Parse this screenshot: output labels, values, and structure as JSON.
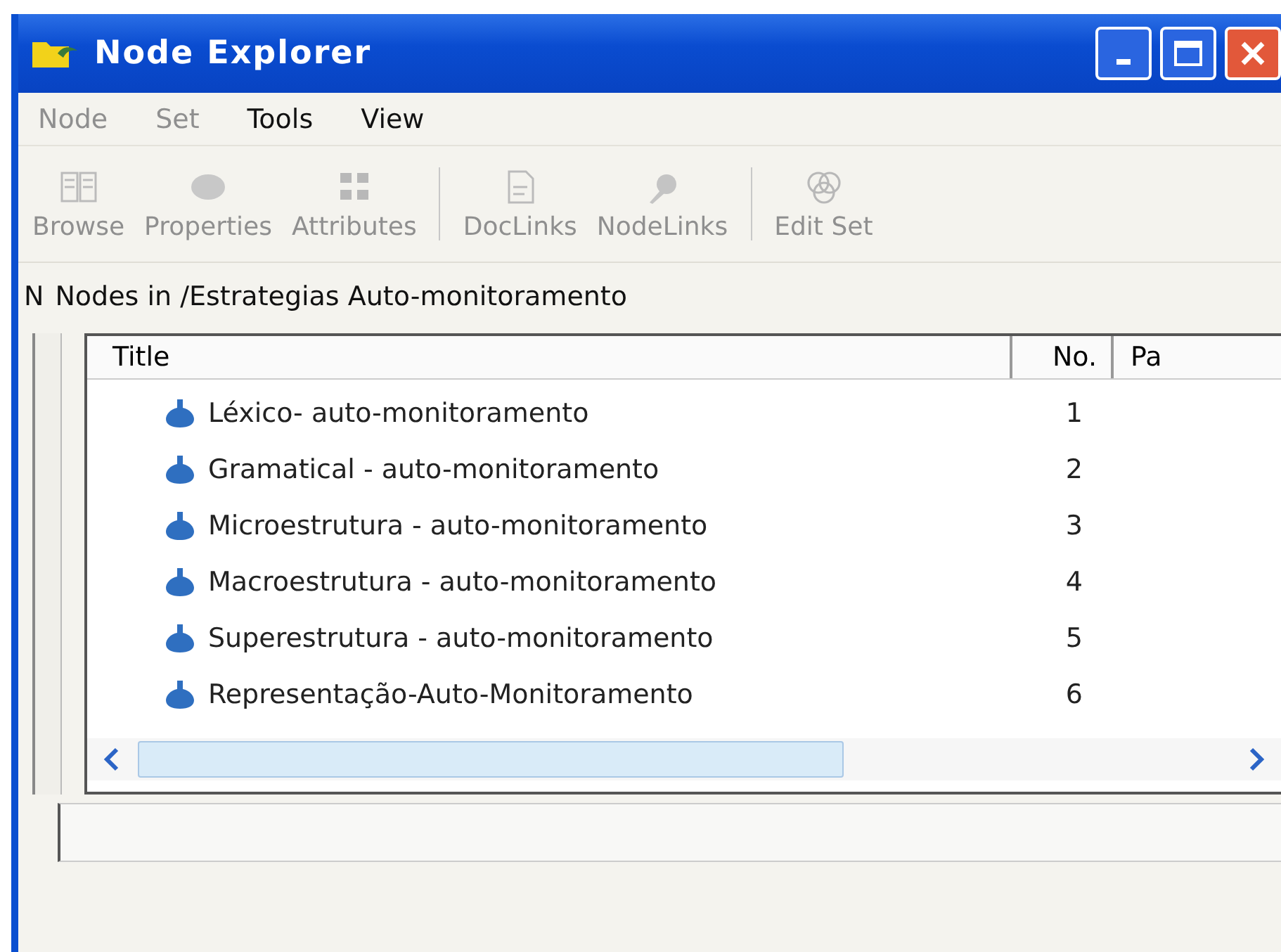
{
  "window": {
    "title": "Node Explorer"
  },
  "menu": [
    {
      "label": "Node",
      "disabled": true
    },
    {
      "label": "Set",
      "disabled": true
    },
    {
      "label": "Tools",
      "disabled": false
    },
    {
      "label": "View",
      "disabled": false
    }
  ],
  "toolbar": [
    [
      {
        "label": "Browse",
        "kind": "book",
        "disabled": true
      },
      {
        "label": "Properties",
        "kind": "disc",
        "disabled": true
      },
      {
        "label": "Attributes",
        "kind": "grid",
        "disabled": true
      }
    ],
    [
      {
        "label": "DocLinks",
        "kind": "doc",
        "disabled": true
      },
      {
        "label": "NodeLinks",
        "kind": "pin",
        "disabled": true
      }
    ],
    [
      {
        "label": "Edit Set",
        "kind": "rings",
        "disabled": true
      }
    ]
  ],
  "path": {
    "prefix": "N",
    "label": "Nodes in /Estrategias Auto-monitoramento"
  },
  "table": {
    "columns": [
      "Title",
      "No.",
      "Pa"
    ],
    "rows": [
      {
        "title": "Léxico- auto-monitoramento",
        "no": "1"
      },
      {
        "title": "Gramatical - auto-monitoramento",
        "no": "2"
      },
      {
        "title": "Microestrutura - auto-monitoramento",
        "no": "3"
      },
      {
        "title": "Macroestrutura - auto-monitoramento",
        "no": "4"
      },
      {
        "title": "Superestrutura - auto-monitoramento",
        "no": "5"
      },
      {
        "title": "Representação-Auto-Monitoramento",
        "no": "6"
      }
    ]
  }
}
